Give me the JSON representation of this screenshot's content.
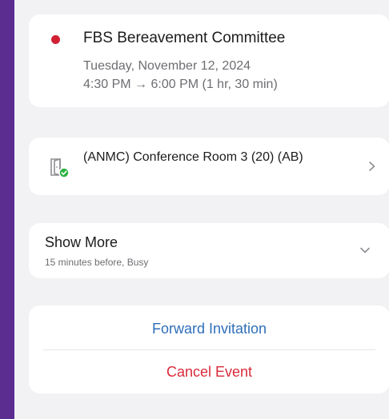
{
  "event": {
    "title": "FBS Bereavement Committee",
    "date": "Tuesday, November 12, 2024",
    "time": "4:30 PM → 6:00 PM (1 hr, 30 min)",
    "color": "#d11f33"
  },
  "location": {
    "name": "(ANMC) Conference Room 3 (20) (AB)",
    "icon": "room-available-icon",
    "status_color": "#2fb344"
  },
  "show_more": {
    "label": "Show More",
    "detail": "15 minutes before, Busy"
  },
  "actions": {
    "forward_label": "Forward Invitation",
    "cancel_label": "Cancel Event",
    "forward_color": "#2f6fb8",
    "cancel_color": "#d92b3a"
  }
}
